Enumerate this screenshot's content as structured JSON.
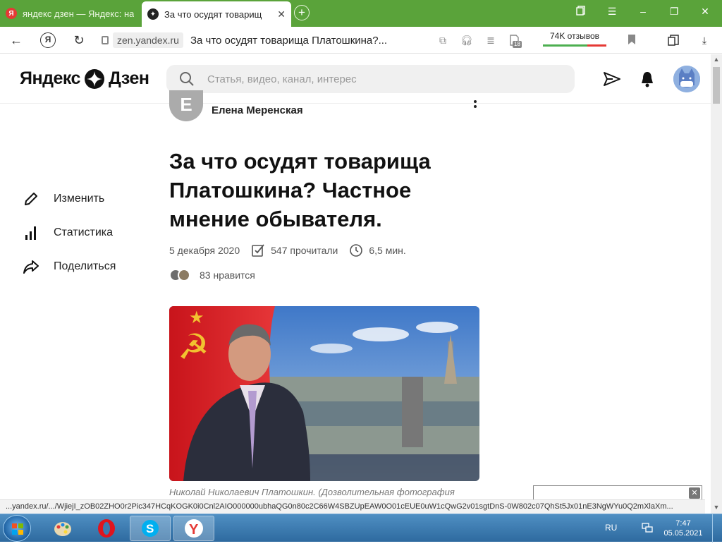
{
  "browser": {
    "tabs": [
      {
        "title": "яндекс дзен — Яндекс: на",
        "favicon": "yandex-icon",
        "active": false
      },
      {
        "title": "За что осудят товарищ",
        "favicon": "dzen-icon",
        "active": true
      }
    ],
    "address": {
      "domain": "zen.yandex.ru",
      "page_title": "За что осудят товарища Платошкина?..."
    },
    "reviews_label": "74K отзывов",
    "extensions_badge": "18"
  },
  "site": {
    "logo_left": "Яндекс",
    "logo_right": "Дзен",
    "search_placeholder": "Статья, видео, канал, интерес"
  },
  "sidebar": {
    "items": [
      {
        "label": "Изменить",
        "icon": "pencil-icon"
      },
      {
        "label": "Статистика",
        "icon": "bar-chart-icon"
      },
      {
        "label": "Поделиться",
        "icon": "share-arrow-icon"
      }
    ]
  },
  "article": {
    "author_initial": "Е",
    "author_name": "Елена Меренская",
    "title": "За что осудят товарища Платошкина? Частное мнение обывателя.",
    "date": "5 декабря 2020",
    "reads": "547 прочитали",
    "read_time": "6,5 мин.",
    "likes": "83 нравится",
    "caption": "Николай Николаевич Платошкин. (Дозволительная фотография"
  },
  "status_url": "...yandex.ru/.../WjiejI_zOB02ZHO0r2Pic347HCqKOGK0i0Cnl2AIO000000ubhaQG0n80c2C66W4SBZUpEAW0O01cEUE0uW1cQwG2v01sgtDnS-0W802c07QhSt5Jx01nE3NgWYu0Q2mXlaXm...",
  "taskbar": {
    "language": "RU",
    "time": "7:47",
    "date": "05.05.2021"
  },
  "colors": {
    "tab_bar": "#5aa33a",
    "taskbar": "#3a7ab0"
  }
}
